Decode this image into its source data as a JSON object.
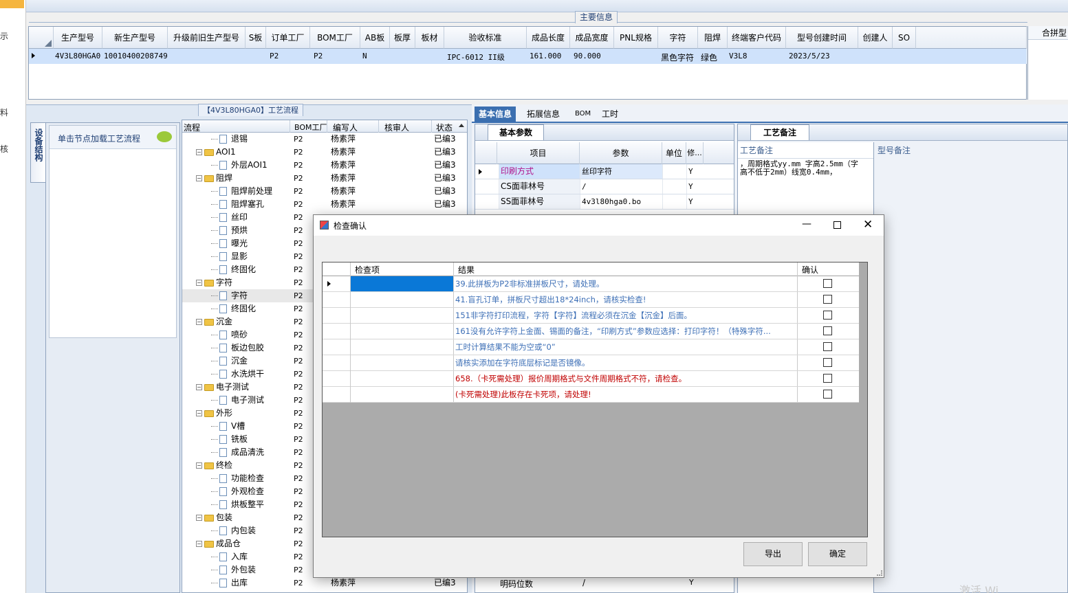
{
  "left_sidebar": {
    "items": [
      "示",
      "料",
      "核"
    ]
  },
  "main_info": {
    "section_label": "主要信息",
    "columns": [
      "生产型号",
      "新生产型号",
      "升级前旧生产型号",
      "S板",
      "订单工厂",
      "BOM工厂",
      "AB板",
      "板厚",
      "板材",
      "验收标准",
      "成品长度",
      "成品宽度",
      "PNL规格",
      "字符",
      "阻焊",
      "终端客户代码",
      "型号创建时间",
      "创建人",
      "SO"
    ],
    "row": {
      "生产型号": "4V3L80HGA0",
      "新生产型号": "10010400208749",
      "订单工厂": "P2",
      "BOM工厂": "P2",
      "AB板": "N",
      "验收标准": "IPC-6012 II级",
      "成品长度": "161.000",
      "成品宽度": "90.000",
      "字符": "黑色字符",
      "阻焊": "绿色",
      "终端客户代码": "V3L8",
      "型号创建时间": "2023/5/23"
    },
    "right_column": "合拼型"
  },
  "process_section": {
    "label": "【4V3L80HGA0】工艺流程",
    "side_tab": "设备结构",
    "hint": "单击节点加载工艺流程",
    "columns": [
      "流程",
      "BOM工厂",
      "编写人",
      "核审人",
      "状态"
    ],
    "rows": [
      {
        "name": "退锡",
        "level": 2,
        "bom": "P2",
        "writer": "杨素萍",
        "status": "已编3"
      },
      {
        "name": "AOI1",
        "level": 1,
        "bom": "P2",
        "writer": "杨素萍",
        "status": "已编3"
      },
      {
        "name": "外层AOI1",
        "level": 2,
        "bom": "P2",
        "writer": "杨素萍",
        "status": "已编3"
      },
      {
        "name": "阻焊",
        "level": 1,
        "bom": "P2",
        "writer": "杨素萍",
        "status": "已编3"
      },
      {
        "name": "阻焊前处理",
        "level": 2,
        "bom": "P2",
        "writer": "杨素萍",
        "status": "已编3"
      },
      {
        "name": "阻焊塞孔",
        "level": 2,
        "bom": "P2",
        "writer": "杨素萍",
        "status": "已编3"
      },
      {
        "name": "丝印",
        "level": 2,
        "bom": "P2",
        "writer": "",
        "status": ""
      },
      {
        "name": "预烘",
        "level": 2,
        "bom": "P2",
        "writer": "",
        "status": ""
      },
      {
        "name": "曝光",
        "level": 2,
        "bom": "P2",
        "writer": "",
        "status": ""
      },
      {
        "name": "显影",
        "level": 2,
        "bom": "P2",
        "writer": "",
        "status": ""
      },
      {
        "name": "终固化",
        "level": 2,
        "bom": "P2",
        "writer": "",
        "status": ""
      },
      {
        "name": "字符",
        "level": 1,
        "bom": "P2",
        "writer": "",
        "status": ""
      },
      {
        "name": "字符",
        "level": 2,
        "bom": "P2",
        "writer": "",
        "status": "",
        "selected": true
      },
      {
        "name": "终固化",
        "level": 2,
        "bom": "P2",
        "writer": "",
        "status": ""
      },
      {
        "name": "沉金",
        "level": 1,
        "bom": "P2",
        "writer": "",
        "status": ""
      },
      {
        "name": "喷砂",
        "level": 2,
        "bom": "P2",
        "writer": "",
        "status": ""
      },
      {
        "name": "板边包胶",
        "level": 2,
        "bom": "P2",
        "writer": "",
        "status": ""
      },
      {
        "name": "沉金",
        "level": 2,
        "bom": "P2",
        "writer": "",
        "status": ""
      },
      {
        "name": "水洗烘干",
        "level": 2,
        "bom": "P2",
        "writer": "",
        "status": ""
      },
      {
        "name": "电子测试",
        "level": 1,
        "bom": "P2",
        "writer": "",
        "status": ""
      },
      {
        "name": "电子测试",
        "level": 2,
        "bom": "P2",
        "writer": "",
        "status": ""
      },
      {
        "name": "外形",
        "level": 1,
        "bom": "P2",
        "writer": "",
        "status": ""
      },
      {
        "name": "V槽",
        "level": 2,
        "bom": "P2",
        "writer": "",
        "status": ""
      },
      {
        "name": "铣板",
        "level": 2,
        "bom": "P2",
        "writer": "",
        "status": ""
      },
      {
        "name": "成品清洗",
        "level": 2,
        "bom": "P2",
        "writer": "",
        "status": ""
      },
      {
        "name": "终检",
        "level": 1,
        "bom": "P2",
        "writer": "",
        "status": ""
      },
      {
        "name": "功能检查",
        "level": 2,
        "bom": "P2",
        "writer": "",
        "status": ""
      },
      {
        "name": "外观检查",
        "level": 2,
        "bom": "P2",
        "writer": "",
        "status": ""
      },
      {
        "name": "烘板整平",
        "level": 2,
        "bom": "P2",
        "writer": "",
        "status": ""
      },
      {
        "name": "包装",
        "level": 1,
        "bom": "P2",
        "writer": "",
        "status": ""
      },
      {
        "name": "内包装",
        "level": 2,
        "bom": "P2",
        "writer": "",
        "status": ""
      },
      {
        "name": "成品仓",
        "level": 1,
        "bom": "P2",
        "writer": "",
        "status": ""
      },
      {
        "name": "入库",
        "level": 2,
        "bom": "P2",
        "writer": "",
        "status": ""
      },
      {
        "name": "外包装",
        "level": 2,
        "bom": "P2",
        "writer": "",
        "status": ""
      },
      {
        "name": "出库",
        "level": 2,
        "bom": "P2",
        "writer": "杨素萍",
        "status": "已编3"
      }
    ]
  },
  "detail_tabs": [
    "基本信息",
    "拓展信息",
    "BOM",
    "工时"
  ],
  "basic_params": {
    "tab": "基本参数",
    "columns": [
      "项目",
      "参数",
      "单位",
      "修..."
    ],
    "rows": [
      {
        "item": "印刷方式",
        "value": "丝印字符",
        "unit": "",
        "mod": "Y"
      },
      {
        "item": "CS面菲林号",
        "value": "/",
        "unit": "",
        "mod": "Y"
      },
      {
        "item": "SS面菲林号",
        "value": "4v3l80hga0.bo",
        "unit": "",
        "mod": "Y"
      }
    ],
    "bottom_row": {
      "item": "明码位数",
      "value": "/",
      "mod": "Y"
    }
  },
  "notes": {
    "tab": "工艺备注",
    "process_note_label": "工艺备注",
    "model_note_label": "型号备注",
    "process_note_text": "，周期格式yy.mm 字高2.5mm（字高不低于2mm）线宽0.4mm，"
  },
  "dialog": {
    "title": "检查确认",
    "columns": [
      "检查项",
      "结果",
      "确认"
    ],
    "rows": [
      {
        "text": "39.此拼板为P2非标准拼板尺寸，请处理。",
        "color": "#3d6fb6"
      },
      {
        "text": "41.盲孔订单，拼板尺寸超出18*24inch，请核实检查!",
        "color": "#3d6fb6"
      },
      {
        "text": "151非字符打印流程，字符【字符】流程必须在沉金【沉金】后面。",
        "color": "#3d6fb6"
      },
      {
        "text": "161没有允许字符上金面、锡面的备注，“印刷方式”参数应选择：打印字符！（特殊字符...",
        "color": "#3d6fb6"
      },
      {
        "text": "工时计算结果不能为空或“0”",
        "color": "#3d6fb6"
      },
      {
        "text": "请核实添加在字符底层标记是否镜像。",
        "color": "#3d6fb6"
      },
      {
        "text": "658.（卡死需处理）报价周期格式与文件周期格式不符，请检查。",
        "color": "#c00000"
      },
      {
        "text": "(卡死需处理)此板存在卡死项，请处理!",
        "color": "#c00000"
      }
    ],
    "export_label": "导出",
    "ok_label": "确定"
  },
  "watermark": "激活 Wi"
}
